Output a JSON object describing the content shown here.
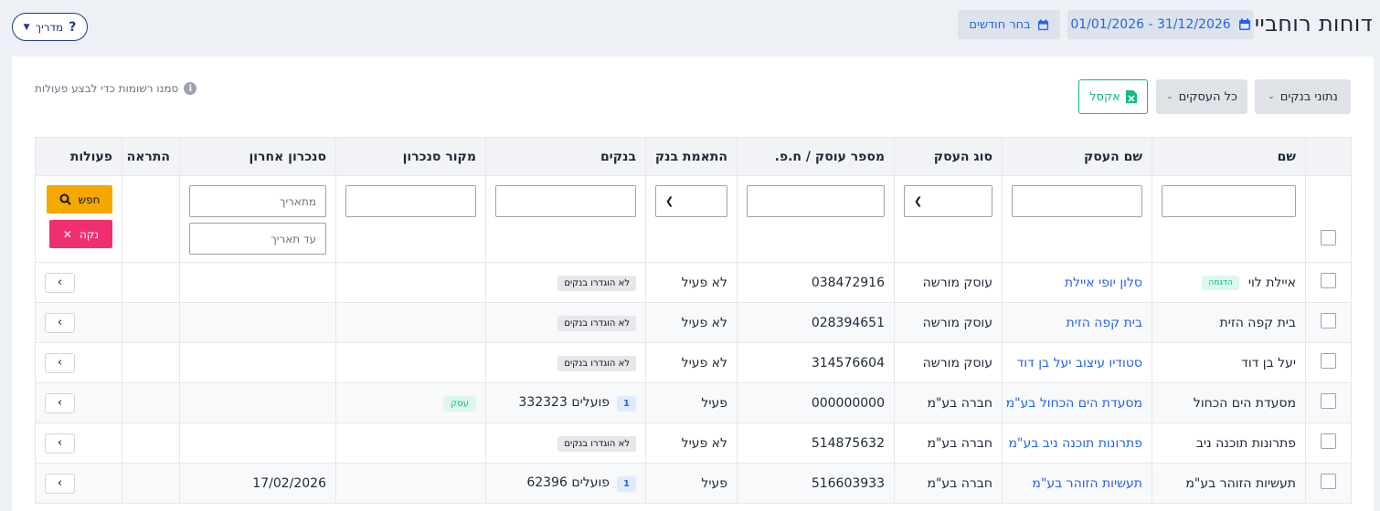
{
  "header": {
    "title": "דוחות רוחביים",
    "date_range": "31/12/2026 - 01/01/2026",
    "choose_months": "בחר חודשים",
    "guide": "מדריך"
  },
  "toolbar": {
    "bank_data": "נתוני בנקים",
    "all_businesses": "כל העסקים",
    "excel": "אקסל",
    "hint": "סמנו רשומות כדי לבצע פעולות"
  },
  "table": {
    "columns": {
      "name": "שם",
      "business_name": "שם העסק",
      "business_type": "סוג העסק",
      "tax_id": "מספר עוסק / ח.פ.",
      "bank_match": "התאמת בנק",
      "banks": "בנקים",
      "sync_source": "מקור סנכרון",
      "last_sync": "סנכרון אחרון",
      "alert": "התראה",
      "actions": "פעולות"
    },
    "filters": {
      "from_date": "מתאריך",
      "to_date": "עד תאריך",
      "search": "חפש",
      "clear": "נקה"
    },
    "rows": [
      {
        "name": "איילת לוי",
        "badge": "הדגמה",
        "business_name": "סלון יופי איילת",
        "business_type": "עוסק מורשה",
        "tax_id": "038472916",
        "bank_match": "לא פעיל",
        "banks_badge": "לא הוגדרו בנקים",
        "bank_count": "",
        "bank_text": "",
        "source": "",
        "last_sync": ""
      },
      {
        "name": "בית קפה הזית",
        "badge": "",
        "business_name": "בית קפה הזית",
        "business_type": "עוסק מורשה",
        "tax_id": "028394651",
        "bank_match": "לא פעיל",
        "banks_badge": "לא הוגדרו בנקים",
        "bank_count": "",
        "bank_text": "",
        "source": "",
        "last_sync": ""
      },
      {
        "name": "יעל בן דוד",
        "badge": "",
        "business_name": "סטודיו עיצוב יעל בן דוד",
        "business_type": "עוסק מורשה",
        "tax_id": "314576604",
        "bank_match": "לא פעיל",
        "banks_badge": "לא הוגדרו בנקים",
        "bank_count": "",
        "bank_text": "",
        "source": "",
        "last_sync": ""
      },
      {
        "name": "מסעדת הים הכחול",
        "badge": "",
        "business_name": "מסעדת הים הכחול בע\"מ",
        "business_type": "חברה בע\"מ",
        "tax_id": "000000000",
        "bank_match": "פעיל",
        "banks_badge": "",
        "bank_count": "1",
        "bank_text": "פועלים 332323",
        "source": "עסק",
        "last_sync": ""
      },
      {
        "name": "פתרונות תוכנה ניב",
        "badge": "",
        "business_name": "פתרונות תוכנה ניב בע\"מ",
        "business_type": "חברה בע\"מ",
        "tax_id": "514875632",
        "bank_match": "לא פעיל",
        "banks_badge": "לא הוגדרו בנקים",
        "bank_count": "",
        "bank_text": "",
        "source": "",
        "last_sync": ""
      },
      {
        "name": "תעשיות הזוהר בע\"מ",
        "badge": "",
        "business_name": "תעשיות הזוהר בע\"מ",
        "business_type": "חברה בע\"מ",
        "tax_id": "516603933",
        "bank_match": "פעיל",
        "banks_badge": "",
        "bank_count": "1",
        "bank_text": "פועלים 62396",
        "source": "",
        "last_sync": "17/02/2026"
      }
    ]
  },
  "icons": {
    "calendar": "calendar-icon",
    "chevron_down": "chevron-down-icon",
    "help": "question-icon",
    "excel": "excel-file-icon",
    "info": "info-icon",
    "search": "search-icon",
    "close": "close-icon",
    "chevron_right": "chevron-right-icon"
  },
  "colors": {
    "primary": "#2563eb",
    "excel_green": "#12b886",
    "search_yellow": "#f5a800",
    "clear_pink": "#f0306e"
  }
}
